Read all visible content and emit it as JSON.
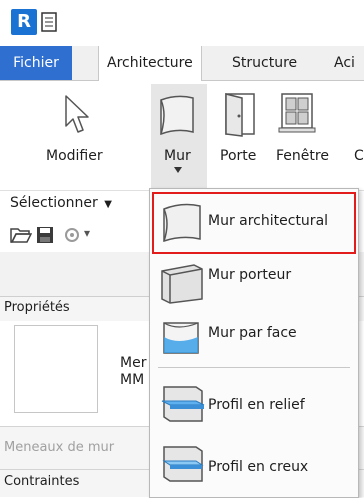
{
  "app": {
    "logo_letter": "R"
  },
  "tabs": [
    {
      "label": "Fichier",
      "active": false
    },
    {
      "label": "Architecture",
      "active": true
    },
    {
      "label": "Structure",
      "active": false
    },
    {
      "label": "Aci",
      "active": false
    }
  ],
  "ribbon": {
    "tools": [
      {
        "label": "Modifier",
        "icon": "cursor-arrow-icon"
      },
      {
        "label": "Mur",
        "icon": "wall-icon"
      },
      {
        "label": "Porte",
        "icon": "door-icon"
      },
      {
        "label": "Fenêtre",
        "icon": "window-icon"
      },
      {
        "label": "C",
        "icon": ""
      }
    ],
    "select_panel": "Sélectionner",
    "select_arrow": "▼"
  },
  "quick_access": {
    "icons": [
      "open-folder-icon",
      "save-icon",
      "sync-icon"
    ],
    "dropdown_glyph": "▾"
  },
  "properties": {
    "title": "Propriétés",
    "type_line1": "Mer",
    "type_line2": "MM",
    "type_selector": "Meneaux de mur",
    "section": "Contraintes"
  },
  "wall_menu": {
    "items": [
      {
        "label": "Mur architectural",
        "icon": "architectural-wall-icon",
        "highlighted": true
      },
      {
        "label": "Mur porteur",
        "icon": "structural-wall-icon",
        "highlighted": false
      },
      {
        "label": "Mur par face",
        "icon": "wall-by-face-icon",
        "highlighted": false
      },
      {
        "label": "Profil en relief",
        "icon": "wall-sweep-icon",
        "highlighted": false
      },
      {
        "label": "Profil en creux",
        "icon": "wall-reveal-icon",
        "highlighted": false
      }
    ]
  },
  "colors": {
    "accent_blue": "#2e6fd0",
    "highlight_red": "#e21b1b"
  }
}
